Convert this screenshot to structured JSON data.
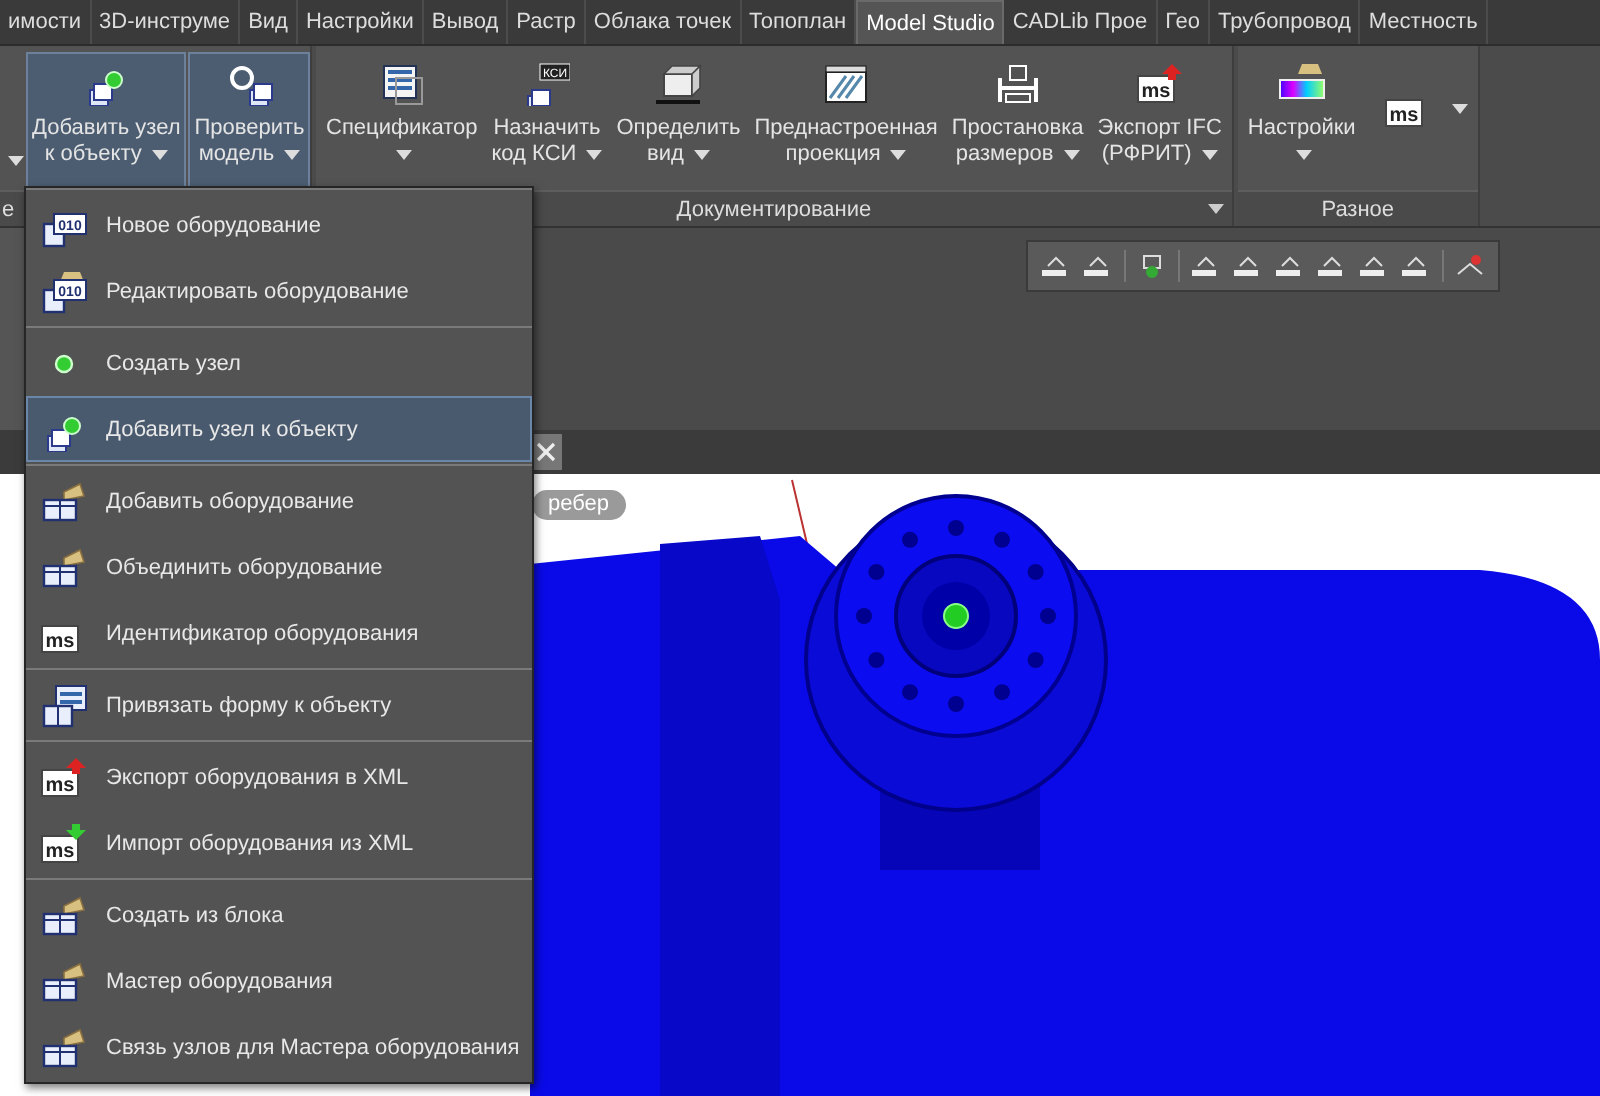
{
  "tabs": [
    {
      "label": "имости",
      "selected": false
    },
    {
      "label": "3D-инструме",
      "selected": false
    },
    {
      "label": "Вид",
      "selected": false
    },
    {
      "label": "Настройки",
      "selected": false
    },
    {
      "label": "Вывод",
      "selected": false
    },
    {
      "label": "Растр",
      "selected": false
    },
    {
      "label": "Облака точек",
      "selected": false
    },
    {
      "label": "Топоплан",
      "selected": false
    },
    {
      "label": "Model Studio",
      "selected": true
    },
    {
      "label": "CADLib Прое",
      "selected": false
    },
    {
      "label": "Гео",
      "selected": false
    },
    {
      "label": "Трубопровод",
      "selected": false
    },
    {
      "label": "Местность",
      "selected": false
    }
  ],
  "ribbon": {
    "panels": [
      {
        "label": "е",
        "expander": false,
        "buttons": [
          {
            "kind": "more"
          },
          {
            "kind": "node-add",
            "lines": [
              "Добавить узел",
              "к объекту"
            ],
            "active": true
          },
          {
            "kind": "check-model",
            "lines": [
              "Проверить",
              "модель"
            ],
            "active": true
          }
        ]
      },
      {
        "label": "Документирование",
        "expander": true,
        "buttons": [
          {
            "kind": "spec",
            "lines": [
              "Спецификатор"
            ],
            "active": false
          },
          {
            "kind": "ksi",
            "icon_text": "КСИ",
            "lines": [
              "Назначить",
              "код КСИ"
            ],
            "active": false
          },
          {
            "kind": "view",
            "lines": [
              "Определить",
              "вид"
            ],
            "active": false
          },
          {
            "kind": "projection",
            "lines": [
              "Преднастроенная",
              "проекция"
            ],
            "active": false
          },
          {
            "kind": "dimension",
            "lines": [
              "Простановка",
              "размеров"
            ],
            "active": false
          },
          {
            "kind": "ms-export",
            "icon_text": "ms",
            "lines": [
              "Экспорт IFC",
              "(РФРИТ)"
            ],
            "active": false
          }
        ]
      },
      {
        "label": "Разное",
        "expander": false,
        "buttons": [
          {
            "kind": "palette",
            "lines": [
              "Настройки"
            ],
            "active": false
          },
          {
            "kind": "ms",
            "icon_text": "ms",
            "active": false
          }
        ]
      }
    ]
  },
  "menu": {
    "groups": [
      [
        {
          "kind": "equipment-code",
          "icon_text": "010",
          "label": "Новое оборудование",
          "selected": false
        },
        {
          "kind": "equipment-code-edit",
          "icon_text": "010",
          "label": "Редактировать оборудование",
          "selected": false
        }
      ],
      [
        {
          "kind": "node",
          "label": "Создать узел",
          "selected": false
        },
        {
          "kind": "node-add",
          "label": "Добавить узел к объекту",
          "selected": true
        }
      ],
      [
        {
          "kind": "equipment",
          "label": "Добавить оборудование",
          "selected": false
        },
        {
          "kind": "equipment",
          "label": "Объединить оборудование",
          "selected": false
        },
        {
          "kind": "ms",
          "icon_text": "ms",
          "label": "Идентификатор оборудования",
          "selected": false
        }
      ],
      [
        {
          "kind": "form",
          "label": "Привязать форму к объекту",
          "selected": false
        }
      ],
      [
        {
          "kind": "ms-export",
          "icon_text": "ms",
          "label": "Экспорт оборудования в XML",
          "selected": false
        },
        {
          "kind": "ms-import",
          "icon_text": "ms",
          "label": "Импорт оборудования из XML",
          "selected": false
        }
      ],
      [
        {
          "kind": "equipment",
          "label": "Создать из блока",
          "selected": false
        },
        {
          "kind": "equipment",
          "label": "Мастер оборудования",
          "selected": false
        },
        {
          "kind": "equipment",
          "label": "Связь узлов для Мастера оборудования",
          "selected": false
        }
      ]
    ]
  },
  "viewport": {
    "overlay_label": "ребер"
  }
}
